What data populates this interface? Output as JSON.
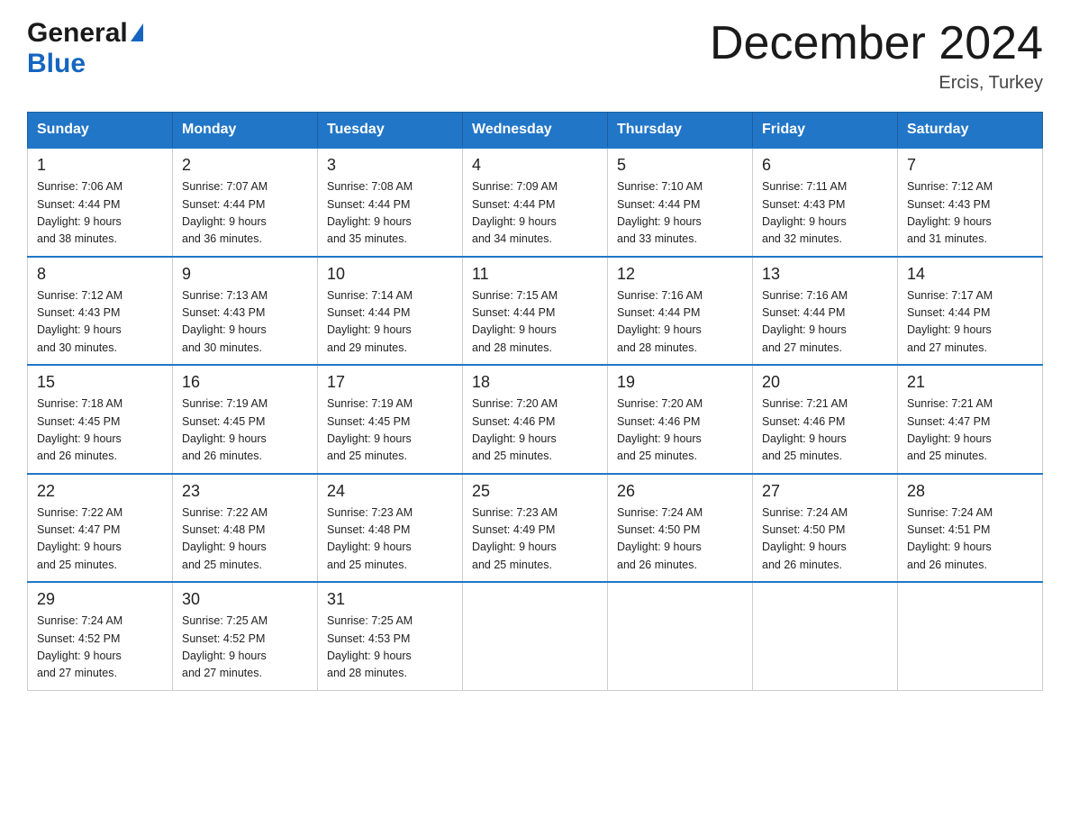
{
  "header": {
    "logo_general": "General",
    "logo_blue": "Blue",
    "month_title": "December 2024",
    "location": "Ercis, Turkey"
  },
  "weekdays": [
    "Sunday",
    "Monday",
    "Tuesday",
    "Wednesday",
    "Thursday",
    "Friday",
    "Saturday"
  ],
  "weeks": [
    [
      {
        "day": "1",
        "sunrise": "7:06 AM",
        "sunset": "4:44 PM",
        "daylight": "9 hours and 38 minutes."
      },
      {
        "day": "2",
        "sunrise": "7:07 AM",
        "sunset": "4:44 PM",
        "daylight": "9 hours and 36 minutes."
      },
      {
        "day": "3",
        "sunrise": "7:08 AM",
        "sunset": "4:44 PM",
        "daylight": "9 hours and 35 minutes."
      },
      {
        "day": "4",
        "sunrise": "7:09 AM",
        "sunset": "4:44 PM",
        "daylight": "9 hours and 34 minutes."
      },
      {
        "day": "5",
        "sunrise": "7:10 AM",
        "sunset": "4:44 PM",
        "daylight": "9 hours and 33 minutes."
      },
      {
        "day": "6",
        "sunrise": "7:11 AM",
        "sunset": "4:43 PM",
        "daylight": "9 hours and 32 minutes."
      },
      {
        "day": "7",
        "sunrise": "7:12 AM",
        "sunset": "4:43 PM",
        "daylight": "9 hours and 31 minutes."
      }
    ],
    [
      {
        "day": "8",
        "sunrise": "7:12 AM",
        "sunset": "4:43 PM",
        "daylight": "9 hours and 30 minutes."
      },
      {
        "day": "9",
        "sunrise": "7:13 AM",
        "sunset": "4:43 PM",
        "daylight": "9 hours and 30 minutes."
      },
      {
        "day": "10",
        "sunrise": "7:14 AM",
        "sunset": "4:44 PM",
        "daylight": "9 hours and 29 minutes."
      },
      {
        "day": "11",
        "sunrise": "7:15 AM",
        "sunset": "4:44 PM",
        "daylight": "9 hours and 28 minutes."
      },
      {
        "day": "12",
        "sunrise": "7:16 AM",
        "sunset": "4:44 PM",
        "daylight": "9 hours and 28 minutes."
      },
      {
        "day": "13",
        "sunrise": "7:16 AM",
        "sunset": "4:44 PM",
        "daylight": "9 hours and 27 minutes."
      },
      {
        "day": "14",
        "sunrise": "7:17 AM",
        "sunset": "4:44 PM",
        "daylight": "9 hours and 27 minutes."
      }
    ],
    [
      {
        "day": "15",
        "sunrise": "7:18 AM",
        "sunset": "4:45 PM",
        "daylight": "9 hours and 26 minutes."
      },
      {
        "day": "16",
        "sunrise": "7:19 AM",
        "sunset": "4:45 PM",
        "daylight": "9 hours and 26 minutes."
      },
      {
        "day": "17",
        "sunrise": "7:19 AM",
        "sunset": "4:45 PM",
        "daylight": "9 hours and 25 minutes."
      },
      {
        "day": "18",
        "sunrise": "7:20 AM",
        "sunset": "4:46 PM",
        "daylight": "9 hours and 25 minutes."
      },
      {
        "day": "19",
        "sunrise": "7:20 AM",
        "sunset": "4:46 PM",
        "daylight": "9 hours and 25 minutes."
      },
      {
        "day": "20",
        "sunrise": "7:21 AM",
        "sunset": "4:46 PM",
        "daylight": "9 hours and 25 minutes."
      },
      {
        "day": "21",
        "sunrise": "7:21 AM",
        "sunset": "4:47 PM",
        "daylight": "9 hours and 25 minutes."
      }
    ],
    [
      {
        "day": "22",
        "sunrise": "7:22 AM",
        "sunset": "4:47 PM",
        "daylight": "9 hours and 25 minutes."
      },
      {
        "day": "23",
        "sunrise": "7:22 AM",
        "sunset": "4:48 PM",
        "daylight": "9 hours and 25 minutes."
      },
      {
        "day": "24",
        "sunrise": "7:23 AM",
        "sunset": "4:48 PM",
        "daylight": "9 hours and 25 minutes."
      },
      {
        "day": "25",
        "sunrise": "7:23 AM",
        "sunset": "4:49 PM",
        "daylight": "9 hours and 25 minutes."
      },
      {
        "day": "26",
        "sunrise": "7:24 AM",
        "sunset": "4:50 PM",
        "daylight": "9 hours and 26 minutes."
      },
      {
        "day": "27",
        "sunrise": "7:24 AM",
        "sunset": "4:50 PM",
        "daylight": "9 hours and 26 minutes."
      },
      {
        "day": "28",
        "sunrise": "7:24 AM",
        "sunset": "4:51 PM",
        "daylight": "9 hours and 26 minutes."
      }
    ],
    [
      {
        "day": "29",
        "sunrise": "7:24 AM",
        "sunset": "4:52 PM",
        "daylight": "9 hours and 27 minutes."
      },
      {
        "day": "30",
        "sunrise": "7:25 AM",
        "sunset": "4:52 PM",
        "daylight": "9 hours and 27 minutes."
      },
      {
        "day": "31",
        "sunrise": "7:25 AM",
        "sunset": "4:53 PM",
        "daylight": "9 hours and 28 minutes."
      },
      null,
      null,
      null,
      null
    ]
  ],
  "labels": {
    "sunrise_prefix": "Sunrise: ",
    "sunset_prefix": "Sunset: ",
    "daylight_prefix": "Daylight: "
  }
}
